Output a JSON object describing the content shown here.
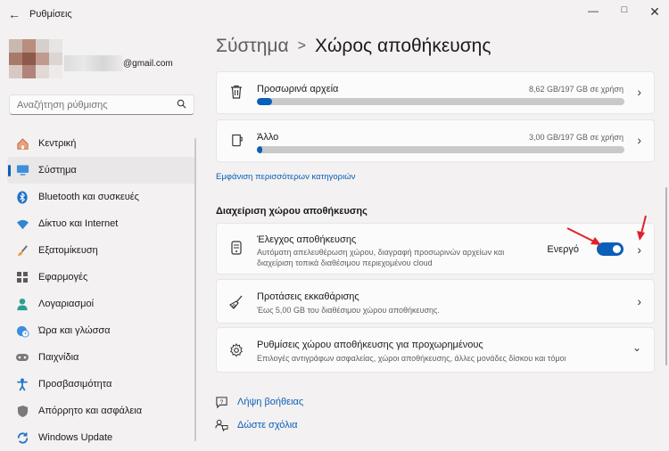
{
  "window": {
    "title": "Ρυθμίσεις",
    "back_icon": "back-arrow-icon",
    "minimize_icon": "minimize-icon",
    "maximize_icon": "maximize-icon",
    "close_icon": "close-icon"
  },
  "profile": {
    "email_suffix": "@gmail.com"
  },
  "search": {
    "placeholder": "Αναζήτηση ρύθμισης",
    "icon": "search-icon"
  },
  "sidebar": {
    "items": [
      {
        "label": "Κεντρική",
        "icon": "home-icon",
        "active": false
      },
      {
        "label": "Σύστημα",
        "icon": "monitor-icon",
        "active": true
      },
      {
        "label": "Bluetooth και συσκευές",
        "icon": "bluetooth-icon",
        "active": false
      },
      {
        "label": "Δίκτυο και Internet",
        "icon": "wifi-icon",
        "active": false
      },
      {
        "label": "Εξατομίκευση",
        "icon": "brush-icon",
        "active": false
      },
      {
        "label": "Εφαρμογές",
        "icon": "apps-icon",
        "active": false
      },
      {
        "label": "Λογαριασμοί",
        "icon": "person-icon",
        "active": false
      },
      {
        "label": "Ώρα και γλώσσα",
        "icon": "clock-globe-icon",
        "active": false
      },
      {
        "label": "Παιχνίδια",
        "icon": "gamepad-icon",
        "active": false
      },
      {
        "label": "Προσβασιμότητα",
        "icon": "accessibility-icon",
        "active": false
      },
      {
        "label": "Απόρρητο και ασφάλεια",
        "icon": "shield-icon",
        "active": false
      },
      {
        "label": "Windows Update",
        "icon": "update-icon",
        "active": false
      }
    ]
  },
  "breadcrumb": {
    "parent": "Σύστημα",
    "separator": ">",
    "current": "Χώρος αποθήκευσης"
  },
  "storage_items": [
    {
      "title": "Προσωρινά αρχεία",
      "usage": "8,62 GB/197 GB σε χρήση",
      "fraction": 0.042,
      "icon": "trash-icon"
    },
    {
      "title": "Άλλο",
      "usage": "3,00 GB/197 GB σε χρήση",
      "fraction": 0.015,
      "icon": "file-icon"
    }
  ],
  "more_categories_link": "Εμφάνιση περισσότερων κατηγοριών",
  "management": {
    "section_title": "Διαχείριση χώρου αποθήκευσης",
    "storage_sense": {
      "title": "Έλεγχος αποθήκευσης",
      "subtitle_line1": "Αυτόματη απελευθέρωση χώρου, διαγραφή προσωρινών αρχείων και",
      "subtitle_line2": "διαχείριση τοπικά διαθέσιμου περιεχομένου cloud",
      "toggle_label": "Ενεργό",
      "toggle_on": true,
      "icon": "drive-icon"
    },
    "cleanup": {
      "title": "Προτάσεις εκκαθάρισης",
      "subtitle": "Έως 5,00 GB του διαθέσιμου χώρου αποθήκευσης.",
      "icon": "broom-icon"
    },
    "advanced": {
      "title": "Ρυθμίσεις χώρου αποθήκευσης για προχωρημένους",
      "subtitle": "Επιλογές αντιγράφων ασφαλείας, χώροι αποθήκευσης, άλλες μονάδες δίσκου και τόμοι",
      "icon": "gear-icon"
    }
  },
  "footer_links": {
    "help": "Λήψη βοήθειας",
    "feedback": "Δώστε σχόλια"
  },
  "colors": {
    "accent": "#0a5fb8",
    "annotation_arrow": "#e0202a"
  }
}
